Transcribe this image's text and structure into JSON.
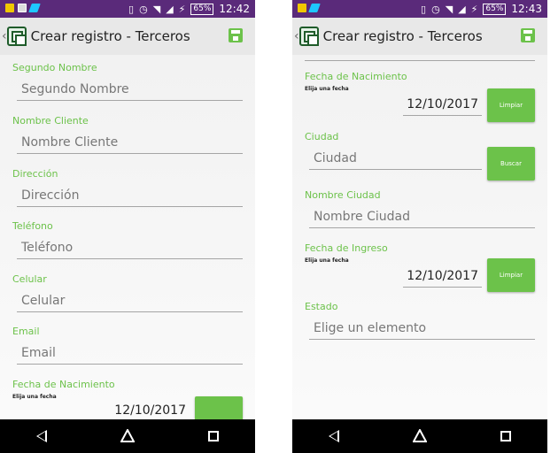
{
  "left": {
    "status": {
      "battery": "65%",
      "time": "12:42"
    },
    "appbar": {
      "title": "Crear registro - Terceros"
    },
    "fields": [
      {
        "label": "Segundo Nombre",
        "placeholder": "Segundo Nombre"
      },
      {
        "label": "Nombre Cliente",
        "placeholder": "Nombre Cliente"
      },
      {
        "label": "Dirección",
        "placeholder": "Dirección"
      },
      {
        "label": "Teléfono",
        "placeholder": "Teléfono"
      },
      {
        "label": "Celular",
        "placeholder": "Celular"
      },
      {
        "label": "Email",
        "placeholder": "Email"
      }
    ],
    "fecha_nacimiento": {
      "label": "Fecha de Nacimiento",
      "sub": "Elija una fecha",
      "value": "12/10/2017"
    }
  },
  "right": {
    "status": {
      "battery": "65%",
      "time": "12:43"
    },
    "appbar": {
      "title": "Crear registro - Terceros"
    },
    "fecha_nacimiento": {
      "label": "Fecha de Nacimiento",
      "sub": "Elija una fecha",
      "value": "12/10/2017",
      "button": "Limpiar"
    },
    "ciudad": {
      "label": "Ciudad",
      "placeholder": "Ciudad",
      "button": "Buscar"
    },
    "nombre_ciudad": {
      "label": "Nombre Ciudad",
      "placeholder": "Nombre Ciudad"
    },
    "fecha_ingreso": {
      "label": "Fecha de Ingreso",
      "sub": "Elija una fecha",
      "value": "12/10/2017",
      "button": "Limpiar"
    },
    "estado": {
      "label": "Estado",
      "placeholder": "Elige un elemento"
    }
  },
  "colors": {
    "accent": "#6cc24a",
    "statusbar": "#5a2a7a",
    "appbar": "#e8e8e8"
  }
}
